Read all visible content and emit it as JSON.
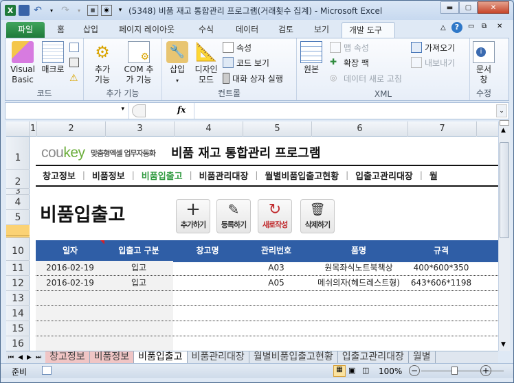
{
  "window": {
    "title": "(5348) 비품 재고 통합관리 프로그램(거래횟수 집계) - Microsoft Excel",
    "controls": [
      "minimize",
      "restore",
      "close"
    ]
  },
  "ribbon_tabs": [
    {
      "label": "파일"
    },
    {
      "label": "홈"
    },
    {
      "label": "삽입"
    },
    {
      "label": "페이지 레이아웃"
    },
    {
      "label": "수식"
    },
    {
      "label": "데이터"
    },
    {
      "label": "검토"
    },
    {
      "label": "보기"
    },
    {
      "label": "개발 도구"
    }
  ],
  "active_tab": "개발 도구",
  "ribbon_groups": {
    "code": {
      "label": "코드",
      "visual_basic": "Visual Basic",
      "macro": "매크로"
    },
    "addins": {
      "label": "추가 기능",
      "addins": "추가 기능",
      "com_addins": "COM 추가 기능"
    },
    "controls": {
      "label": "컨트롤",
      "insert": "삽입",
      "design_mode": "디자인 모드",
      "properties": "속성",
      "view_code": "코드 보기",
      "run_dialog": "대화 상자 실행"
    },
    "xml": {
      "label": "XML",
      "source": "원본",
      "map_properties": "맵 속성",
      "expansion_packs": "확장 팩",
      "refresh_data": "데이터 새로 고침",
      "import": "가져오기",
      "export": "내보내기"
    },
    "modify": {
      "label": "수정",
      "document_panel": "문서 창"
    }
  },
  "formula_bar": {
    "name_box": "",
    "fx": "fx",
    "value": ""
  },
  "columns": [
    "1",
    "2",
    "3",
    "4",
    "5",
    "6",
    "7"
  ],
  "rows": [
    "1",
    "2",
    "3",
    "4",
    "5",
    "10",
    "11",
    "12",
    "13",
    "14",
    "15",
    "16"
  ],
  "sheet": {
    "logo": {
      "brand_a": "cou",
      "brand_b": "key",
      "slogan": "맞춤형엑셀 업무자동화"
    },
    "app_title": "비품 재고 통합관리 프로그램",
    "nav": [
      "창고정보",
      "비품정보",
      "비품입출고",
      "비품관리대장",
      "월별비품입출고현황",
      "입출고관리대장",
      "월"
    ],
    "nav_current": "비품입출고",
    "page_title": "비품입출고",
    "actions": [
      {
        "label": "추가하기",
        "icon": "plus-icon"
      },
      {
        "label": "등록하기",
        "icon": "pencil-icon"
      },
      {
        "label": "새로작성",
        "icon": "refresh-icon"
      },
      {
        "label": "삭제하기",
        "icon": "trash-icon"
      }
    ],
    "table": {
      "headers": [
        "일자",
        "입출고 구분",
        "창고명",
        "관리번호",
        "품명",
        "규격"
      ],
      "rows": [
        [
          "2016-02-19",
          "입고",
          "",
          "A03",
          "원목좌식노트북책상",
          "400*600*350"
        ],
        [
          "2016-02-19",
          "입고",
          "",
          "A05",
          "메쉬의자(헤드레스트형)",
          "643*606*1198"
        ],
        [
          "",
          "",
          "",
          "",
          "",
          ""
        ],
        [
          "",
          "",
          "",
          "",
          "",
          ""
        ],
        [
          "",
          "",
          "",
          "",
          "",
          ""
        ],
        [
          "",
          "",
          "",
          "",
          "",
          ""
        ]
      ]
    }
  },
  "sheet_tabs": [
    "창고정보",
    "비품정보",
    "비품입출고",
    "비품관리대장",
    "월별비품입출고현황",
    "입출고관리대장",
    "월별"
  ],
  "active_sheet": "비품입출고",
  "status": {
    "ready": "준비",
    "zoom": "100%"
  },
  "colors": {
    "header_blue": "#2f5ea6",
    "nav_green": "#2f9a3f",
    "pink_tab": "#f0c5c5",
    "red_action": "#c0292c",
    "file_green": "#2b8a45"
  }
}
